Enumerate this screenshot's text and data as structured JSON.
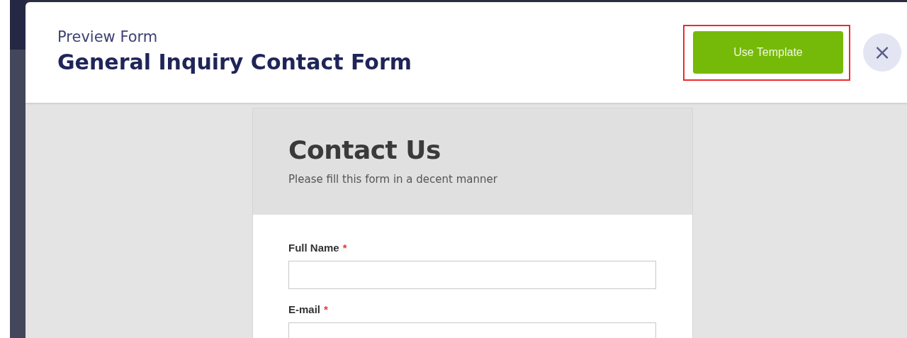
{
  "modal": {
    "subtitle": "Preview Form",
    "title": "General Inquiry Contact Form",
    "primary_button": {
      "label": "Use Template",
      "highlighted": true
    },
    "close_button": {
      "label": "×"
    }
  },
  "form": {
    "title": "Contact Us",
    "description": "Please fill this form in a decent manner",
    "fields": [
      {
        "label": "Full Name",
        "required_mark": "*"
      },
      {
        "label": "E-mail",
        "required_mark": "*"
      }
    ]
  }
}
